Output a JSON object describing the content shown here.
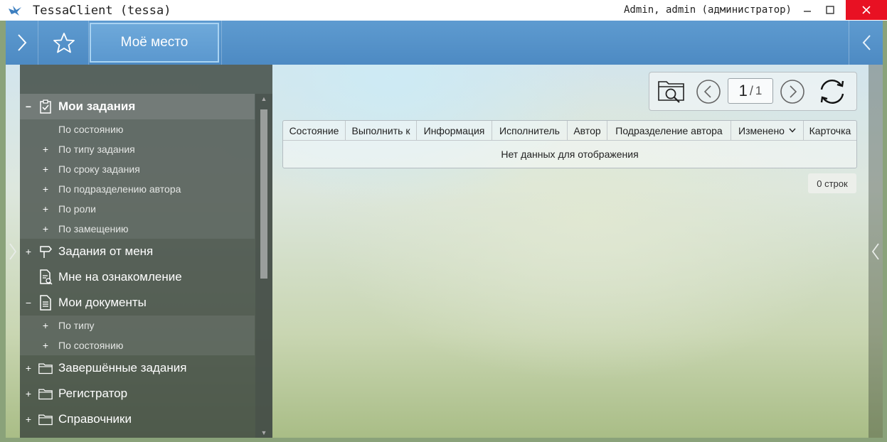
{
  "window": {
    "title": "TessaClient (tessa)",
    "user": "Admin, admin (администратор)",
    "minimize_icon": "minimize-icon",
    "maximize_icon": "maximize-icon",
    "close_icon": "close-icon"
  },
  "topbar": {
    "active_tab": "Моё место"
  },
  "sidebar": {
    "tree": [
      {
        "label": "Мои задания",
        "toggle": "−",
        "icon": "task-check-icon",
        "selected": true,
        "children": [
          {
            "label": "По состоянию",
            "toggle": ""
          },
          {
            "label": "По типу задания",
            "toggle": "+"
          },
          {
            "label": "По сроку задания",
            "toggle": "+"
          },
          {
            "label": "По подразделению автора",
            "toggle": "+"
          },
          {
            "label": "По роли",
            "toggle": "+"
          },
          {
            "label": "По замещению",
            "toggle": "+"
          }
        ]
      },
      {
        "label": "Задания от меня",
        "toggle": "+",
        "icon": "signpost-icon"
      },
      {
        "label": "Мне на ознакомление",
        "toggle": "",
        "icon": "document-review-icon"
      },
      {
        "label": "Мои документы",
        "toggle": "−",
        "icon": "document-icon",
        "children": [
          {
            "label": "По типу",
            "toggle": "+"
          },
          {
            "label": "По состоянию",
            "toggle": "+"
          }
        ]
      },
      {
        "label": "Завершённые задания",
        "toggle": "+",
        "icon": "folder-icon"
      },
      {
        "label": "Регистратор",
        "toggle": "+",
        "icon": "folder-icon"
      },
      {
        "label": "Справочники",
        "toggle": "+",
        "icon": "folder-icon"
      }
    ]
  },
  "toolbar": {
    "page_current": "1",
    "page_separator": "/",
    "page_total": "1"
  },
  "grid": {
    "columns": [
      "Состояние",
      "Выполнить к",
      "Информация",
      "Исполнитель",
      "Автор",
      "Подразделение автора",
      "Изменено",
      "Карточка"
    ],
    "sorted_column": "Изменено",
    "empty_message": "Нет данных для отображения"
  },
  "row_count": "0 строк",
  "colors": {
    "topbar": "#5a97cd",
    "close_button": "#e81123",
    "sidebar": "#3a443e"
  }
}
